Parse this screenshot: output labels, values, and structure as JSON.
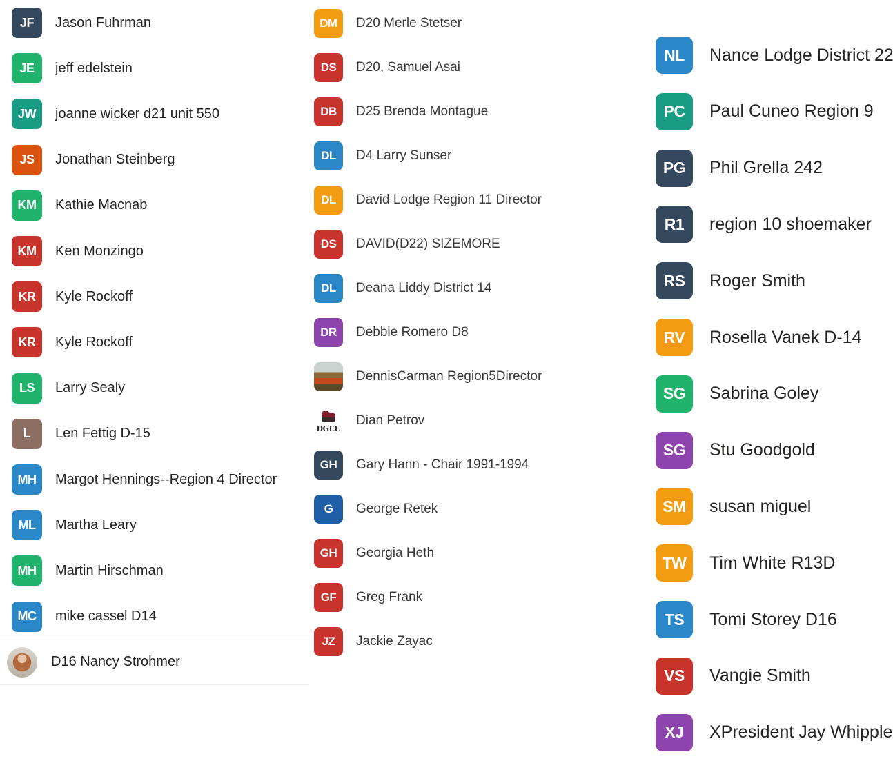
{
  "columns": [
    {
      "contacts": [
        {
          "initials": "JF",
          "name": "Jason Fuhrman",
          "color": "#34495e"
        },
        {
          "initials": "JE",
          "name": "jeff edelstein",
          "color": "#1fb36b"
        },
        {
          "initials": "JW",
          "name": "joanne wicker d21 unit 550",
          "color": "#1a9c84"
        },
        {
          "initials": "JS",
          "name": "Jonathan Steinberg",
          "color": "#d9530f"
        },
        {
          "initials": "KM",
          "name": "Kathie Macnab",
          "color": "#1fb36b"
        },
        {
          "initials": "KM",
          "name": "Ken Monzingo",
          "color": "#c8342b"
        },
        {
          "initials": "KR",
          "name": "Kyle Rockoff",
          "color": "#c8342b"
        },
        {
          "initials": "KR",
          "name": "Kyle Rockoff",
          "color": "#c8342b"
        },
        {
          "initials": "LS",
          "name": "Larry Sealy",
          "color": "#1fb36b"
        },
        {
          "initials": "L",
          "name": "Len Fettig D-15",
          "color": "#8d6e63"
        },
        {
          "initials": "MH",
          "name": "Margot Hennings--Region 4 Director",
          "color": "#2b88c8"
        },
        {
          "initials": "ML",
          "name": "Martha Leary",
          "color": "#2b88c8"
        },
        {
          "initials": "MH",
          "name": "Martin Hirschman",
          "color": "#1fb36b"
        },
        {
          "initials": "MC",
          "name": "mike cassel D14",
          "color": "#2b88c8"
        },
        {
          "initials": "",
          "name": "D16 Nancy Strohmer",
          "color": "#b46a3c",
          "photo": "person",
          "selected": true
        }
      ]
    },
    {
      "contacts": [
        {
          "initials": "DM",
          "name": "D20 Merle Stetser",
          "color": "#f39c12"
        },
        {
          "initials": "DS",
          "name": "D20, Samuel Asai",
          "color": "#c8342b"
        },
        {
          "initials": "DB",
          "name": "D25 Brenda Montague",
          "color": "#c8342b"
        },
        {
          "initials": "DL",
          "name": "D4 Larry Sunser",
          "color": "#2b88c8"
        },
        {
          "initials": "DL",
          "name": "David Lodge Region 11 Director",
          "color": "#f39c12"
        },
        {
          "initials": "DS",
          "name": "DAVID(D22) SIZEMORE",
          "color": "#c8342b"
        },
        {
          "initials": "DL",
          "name": "Deana Liddy  District 14",
          "color": "#2b88c8"
        },
        {
          "initials": "DR",
          "name": "Debbie Romero D8",
          "color": "#8e44ad"
        },
        {
          "initials": "",
          "name": "DennisCarman Region5Director",
          "color": "#8a6a3a",
          "photo": "landscape"
        },
        {
          "initials": "",
          "name": "Dian Petrov",
          "color": "#7a1c2c",
          "photo": "logo",
          "logo_text": "DGEU"
        },
        {
          "initials": "GH",
          "name": "Gary Hann - Chair 1991-1994",
          "color": "#34495e"
        },
        {
          "initials": "G",
          "name": "George Retek",
          "color": "#1f5fa8"
        },
        {
          "initials": "GH",
          "name": "Georgia Heth",
          "color": "#c8342b"
        },
        {
          "initials": "GF",
          "name": "Greg Frank",
          "color": "#c8342b"
        },
        {
          "initials": "JZ",
          "name": "Jackie Zayac",
          "color": "#c8342b"
        }
      ]
    },
    {
      "contacts": [
        {
          "initials": "NL",
          "name": "Nance Lodge District 22",
          "color": "#2b88c8"
        },
        {
          "initials": "PC",
          "name": "Paul Cuneo Region 9",
          "color": "#1a9c84"
        },
        {
          "initials": "PG",
          "name": "Phil Grella  242",
          "color": "#34495e"
        },
        {
          "initials": "R1",
          "name": "region 10 shoemaker",
          "color": "#34495e"
        },
        {
          "initials": "RS",
          "name": "Roger Smith",
          "color": "#34495e"
        },
        {
          "initials": "RV",
          "name": "Rosella Vanek D-14",
          "color": "#f39c12"
        },
        {
          "initials": "SG",
          "name": "Sabrina Goley",
          "color": "#1fb36b"
        },
        {
          "initials": "SG",
          "name": "Stu Goodgold",
          "color": "#8e44ad"
        },
        {
          "initials": "SM",
          "name": "susan miguel",
          "color": "#f39c12"
        },
        {
          "initials": "TW",
          "name": "Tim White R13D",
          "color": "#f39c12"
        },
        {
          "initials": "TS",
          "name": "Tomi Storey D16",
          "color": "#2b88c8"
        },
        {
          "initials": "VS",
          "name": "Vangie Smith",
          "color": "#c8342b"
        },
        {
          "initials": "XJ",
          "name": "XPresident Jay Whipple",
          "color": "#8e44ad"
        }
      ]
    }
  ]
}
